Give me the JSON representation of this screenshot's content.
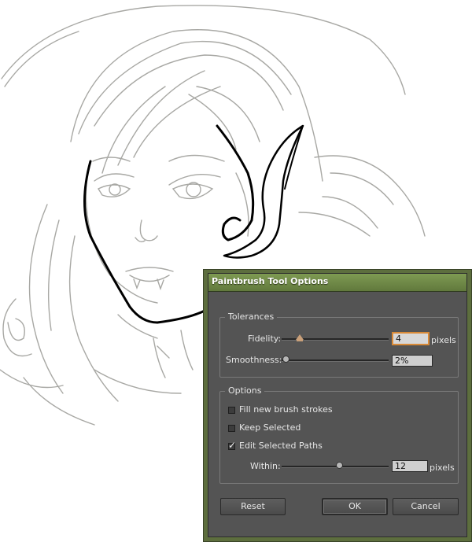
{
  "dialog": {
    "title": "Paintbrush Tool Options",
    "tolerances": {
      "legend": "Tolerances",
      "fidelity": {
        "label": "Fidelity:",
        "value": "4",
        "unit": "pixels"
      },
      "smoothness": {
        "label": "Smoothness:",
        "value": "2%"
      }
    },
    "options": {
      "legend": "Options",
      "checkboxes": [
        {
          "label": "Fill new brush strokes",
          "checked": false
        },
        {
          "label": "Keep Selected",
          "checked": false
        },
        {
          "label": "Edit Selected Paths",
          "checked": true
        }
      ],
      "within": {
        "label": "Within:",
        "value": "12",
        "unit": "pixels"
      }
    },
    "buttons": {
      "reset": "Reset",
      "ok": "OK",
      "cancel": "Cancel"
    }
  },
  "colors": {
    "dialog_chrome": "#5d6e3e",
    "dialog_body": "#545454",
    "focus_ring": "#d98a37",
    "sketch_gray": "#a6a6a6",
    "ink_stroke": "#000000"
  }
}
